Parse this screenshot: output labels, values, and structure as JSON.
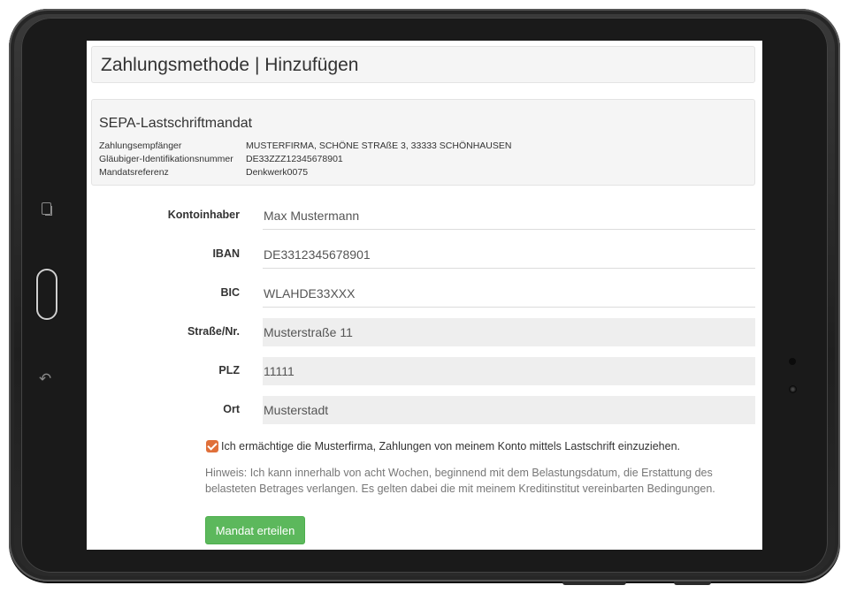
{
  "page": {
    "title": "Zahlungsmethode | Hinzufügen"
  },
  "mandate": {
    "heading": "SEPA-Lastschriftmandat",
    "rows": [
      {
        "label": "Zahlungsempfänger",
        "value": "MUSTERFIRMA, SCHÖNE STRAßE 3, 33333 SCHÖNHAUSEN"
      },
      {
        "label": "Gläubiger-Identifikationsnummer",
        "value": "DE33ZZZ12345678901"
      },
      {
        "label": "Mandatsreferenz",
        "value": "Denkwerk0075"
      }
    ]
  },
  "form": {
    "fields": [
      {
        "label": "Kontoinhaber",
        "value": "Max Mustermann",
        "readonly": false
      },
      {
        "label": "IBAN",
        "value": "DE3312345678901",
        "readonly": false
      },
      {
        "label": "BIC",
        "value": "WLAHDE33XXX",
        "readonly": false
      },
      {
        "label": "Straße/Nr.",
        "value": "Musterstraße 11",
        "readonly": true
      },
      {
        "label": "PLZ",
        "value": "11111",
        "readonly": true
      },
      {
        "label": "Ort",
        "value": "Musterstadt",
        "readonly": true
      }
    ],
    "consent_checked": true,
    "consent_text": "Ich ermächtige die Musterfirma, Zahlungen von meinem Konto mittels Lastschrift einzuziehen.",
    "hint": "Hinweis: Ich kann innerhalb von acht Wochen, beginnend mit dem Belastungsdatum, die Erstattung des belasteten Betrages verlangen. Es gelten dabei die mit meinem Kreditinstitut vereinbarten Bedingungen.",
    "submit_label": "Mandat erteilen"
  },
  "colors": {
    "submit": "#5cb85c",
    "checkbox": "#e0703a",
    "panel_bg": "#f5f5f5",
    "readonly_bg": "#eeeeee"
  },
  "device_icons": [
    "recent-apps-icon",
    "home-button",
    "back-icon"
  ]
}
